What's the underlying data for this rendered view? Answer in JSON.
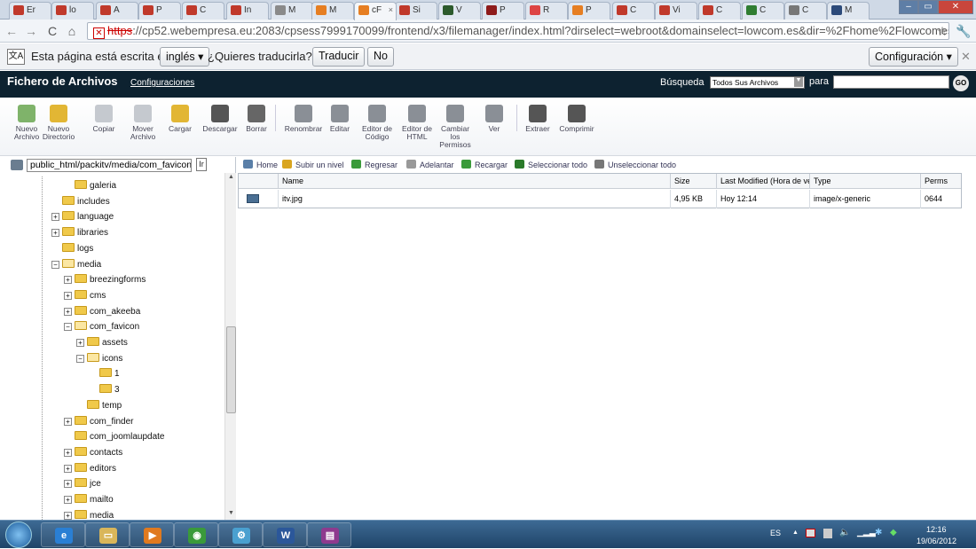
{
  "browser": {
    "tabs": [
      {
        "label": "Er",
        "icon": "w-icon",
        "color": "#c0392b"
      },
      {
        "label": "lo",
        "icon": "w-icon",
        "color": "#c0392b"
      },
      {
        "label": "A",
        "icon": "w-icon",
        "color": "#c0392b"
      },
      {
        "label": "P",
        "icon": "w-icon",
        "color": "#c0392b"
      },
      {
        "label": "C",
        "icon": "w-icon",
        "color": "#c0392b"
      },
      {
        "label": "In",
        "icon": "w-icon",
        "color": "#c0392b"
      },
      {
        "label": "M",
        "icon": "y-icon",
        "color": "#8a8a8a"
      },
      {
        "label": "M",
        "icon": "cp-icon",
        "color": "#e67e22"
      },
      {
        "label": "cF",
        "icon": "cp-icon",
        "color": "#e67e22",
        "active": true
      },
      {
        "label": "Si",
        "icon": "w-icon",
        "color": "#c0392b"
      },
      {
        "label": "V",
        "icon": "v-icon",
        "color": "#2c5a2c"
      },
      {
        "label": "P",
        "icon": "p-icon",
        "color": "#8e1b1b"
      },
      {
        "label": "R",
        "icon": "gmail-icon",
        "color": "#d44"
      },
      {
        "label": "P",
        "icon": "joomla-icon",
        "color": "#e67e22"
      },
      {
        "label": "C",
        "icon": "w-icon",
        "color": "#c0392b"
      },
      {
        "label": "Vi",
        "icon": "w-icon",
        "color": "#c0392b"
      },
      {
        "label": "C",
        "icon": "w-icon",
        "color": "#c0392b"
      },
      {
        "label": "C",
        "icon": "g-icon",
        "color": "#2f7d32"
      },
      {
        "label": "C",
        "icon": "wrench-icon",
        "color": "#777"
      },
      {
        "label": "M",
        "icon": "m-icon",
        "color": "#2c4a7a"
      }
    ],
    "url_https": "https",
    "url_rest": "://cp52.webempresa.eu:2083/cpsess7999170099/frontend/x3/filemanager/index.html?dirselect=webroot&domainselect=lowcom.es&dir=%2Fhome%2Flowcomes%2Fpubl",
    "translate": {
      "prefix": "Esta página está escrita en",
      "language": "inglés",
      "question": "¿Quieres traducirla?",
      "translate_btn": "Traducir",
      "no_btn": "No",
      "config_btn": "Configuración"
    }
  },
  "cpanel": {
    "title": "Fichero de Archivos",
    "settings_link": "Configuraciones",
    "search_label": "Búsqueda",
    "search_scope": "Todos Sus Archivos",
    "for_label": "para",
    "search_value": "",
    "go_label": "GO"
  },
  "toolbar": [
    {
      "label": "Nuevo Archivo",
      "icon": "new-file-icon",
      "color": "#7fb36a"
    },
    {
      "label": "Nuevo Directorio",
      "icon": "new-folder-icon",
      "color": "#e2b634"
    },
    {
      "label": "Copiar",
      "icon": "copy-icon",
      "color": "#c5c9cf"
    },
    {
      "label": "Mover Archivo",
      "icon": "move-icon",
      "color": "#c5c9cf"
    },
    {
      "label": "Cargar",
      "icon": "upload-icon",
      "color": "#e2b634"
    },
    {
      "label": "Descargar",
      "icon": "download-icon",
      "color": "#555"
    },
    {
      "label": "Borrar",
      "icon": "delete-icon",
      "color": "#666"
    },
    {
      "label": "Renombrar",
      "icon": "rename-icon",
      "color": "#8a8f96"
    },
    {
      "label": "Editar",
      "icon": "edit-icon",
      "color": "#8a8f96"
    },
    {
      "label": "Editor de Código",
      "icon": "code-editor-icon",
      "color": "#8a8f96"
    },
    {
      "label": "Editor de HTML",
      "icon": "html-editor-icon",
      "color": "#8a8f96"
    },
    {
      "label": "Cambiar los Permisos",
      "icon": "permissions-icon",
      "color": "#8a8f96"
    },
    {
      "label": "Ver",
      "icon": "view-icon",
      "color": "#8a8f96"
    },
    {
      "label": "Extraer",
      "icon": "extract-icon",
      "color": "#555"
    },
    {
      "label": "Comprimir",
      "icon": "compress-icon",
      "color": "#555"
    }
  ],
  "tree": {
    "path": "public_html/packitv/media/com_favicon",
    "path_go": "Ir",
    "nodes": [
      {
        "label": "galeria",
        "level": 2,
        "pm": "",
        "open": false
      },
      {
        "label": "includes",
        "level": 1,
        "pm": "",
        "open": false
      },
      {
        "label": "language",
        "level": 1,
        "pm": "+",
        "open": false
      },
      {
        "label": "libraries",
        "level": 1,
        "pm": "+",
        "open": false
      },
      {
        "label": "logs",
        "level": 1,
        "pm": "",
        "open": false
      },
      {
        "label": "media",
        "level": 1,
        "pm": "-",
        "open": true
      },
      {
        "label": "breezingforms",
        "level": 2,
        "pm": "+",
        "open": false
      },
      {
        "label": "cms",
        "level": 2,
        "pm": "+",
        "open": false
      },
      {
        "label": "com_akeeba",
        "level": 2,
        "pm": "+",
        "open": false
      },
      {
        "label": "com_favicon",
        "level": 2,
        "pm": "-",
        "open": true
      },
      {
        "label": "assets",
        "level": 3,
        "pm": "+",
        "open": false
      },
      {
        "label": "icons",
        "level": 3,
        "pm": "-",
        "open": true
      },
      {
        "label": "1",
        "level": 4,
        "pm": "",
        "open": false
      },
      {
        "label": "3",
        "level": 4,
        "pm": "",
        "open": false
      },
      {
        "label": "temp",
        "level": 3,
        "pm": "",
        "open": false
      },
      {
        "label": "com_finder",
        "level": 2,
        "pm": "+",
        "open": false
      },
      {
        "label": "com_joomlaupdate",
        "level": 2,
        "pm": "",
        "open": false
      },
      {
        "label": "contacts",
        "level": 2,
        "pm": "+",
        "open": false
      },
      {
        "label": "editors",
        "level": 2,
        "pm": "+",
        "open": false
      },
      {
        "label": "jce",
        "level": 2,
        "pm": "+",
        "open": false
      },
      {
        "label": "mailto",
        "level": 2,
        "pm": "+",
        "open": false
      },
      {
        "label": "media",
        "level": 2,
        "pm": "+",
        "open": false
      }
    ]
  },
  "navrow": [
    {
      "label": "Home",
      "icon": "home-icon",
      "color": "#5a7fa8"
    },
    {
      "label": "Subir un nivel",
      "icon": "up-level-icon",
      "color": "#d9a520"
    },
    {
      "label": "Regresar",
      "icon": "back-icon",
      "color": "#3a9a3a"
    },
    {
      "label": "Adelantar",
      "icon": "forward-icon",
      "color": "#999"
    },
    {
      "label": "Recargar",
      "icon": "reload-icon",
      "color": "#3a9a3a"
    },
    {
      "label": "Seleccionar todo",
      "icon": "checkbox-checked-icon",
      "color": "#2a7a2a"
    },
    {
      "label": "Unseleccionar todo",
      "icon": "checkbox-empty-icon",
      "color": "#777"
    }
  ],
  "files": {
    "columns": [
      "Name",
      "Size",
      "Last Modified (Hora de ve",
      "Type",
      "Perms"
    ],
    "rows": [
      {
        "name": "itv.jpg",
        "size": "4,95 KB",
        "modified": "Hoy 12:14",
        "type": "image/x-generic",
        "perms": "0644"
      }
    ]
  },
  "taskbar": {
    "apps": [
      {
        "name": "ie-icon",
        "glyph": "e",
        "color": "#2a7fd4"
      },
      {
        "name": "explorer-icon",
        "glyph": "▭",
        "color": "#d9b65a"
      },
      {
        "name": "media-player-icon",
        "glyph": "▶",
        "color": "#e07a1f"
      },
      {
        "name": "chrome-icon",
        "glyph": "◉",
        "color": "#3a9a3a"
      },
      {
        "name": "network-icon",
        "glyph": "⚙",
        "color": "#4aa0d0"
      },
      {
        "name": "word-icon",
        "glyph": "W",
        "color": "#2b579a"
      },
      {
        "name": "winrar-icon",
        "glyph": "▤",
        "color": "#8e3a8e"
      }
    ],
    "lang": "ES",
    "time": "12:16",
    "date": "19/06/2012"
  }
}
